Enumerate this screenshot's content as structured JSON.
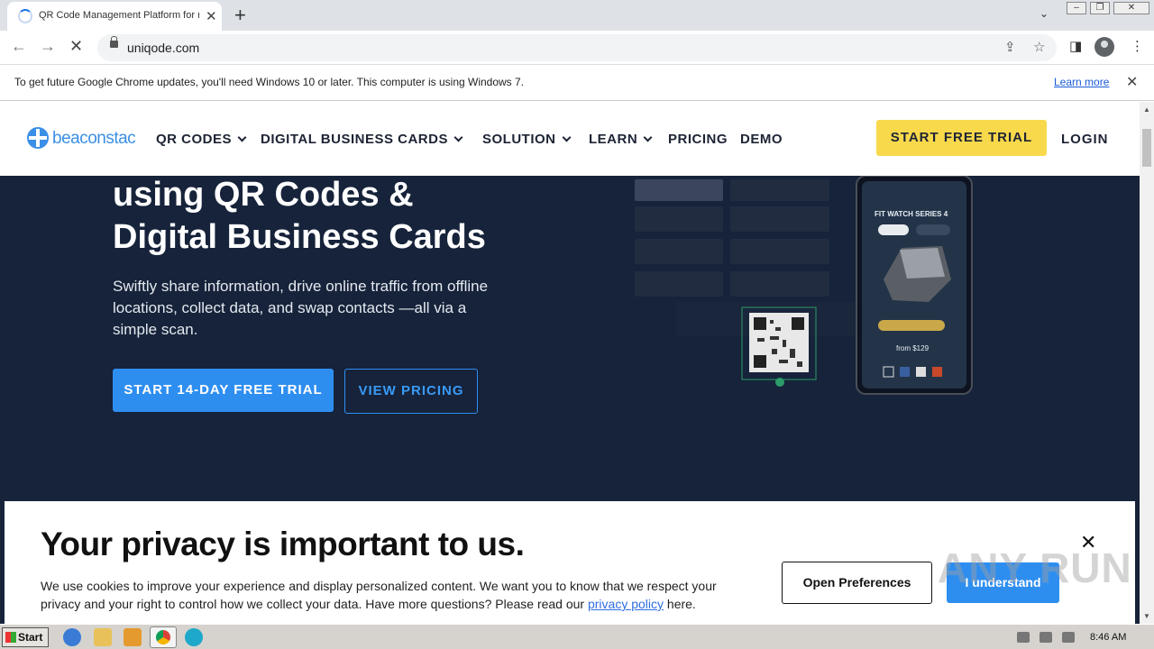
{
  "browser": {
    "tab_title": "QR Code Management Platform for m",
    "url": "uniqode.com",
    "infobar_text": "To get future Google Chrome updates, you'll need Windows 10 or later. This computer is using Windows 7.",
    "infobar_link": "Learn more"
  },
  "site": {
    "logo": "beaconstac",
    "nav": [
      "QR CODES",
      "DIGITAL BUSINESS CARDS",
      "SOLUTION",
      "LEARN",
      "PRICING",
      "DEMO"
    ],
    "cta_trial": "START FREE TRIAL",
    "login": "LOGIN"
  },
  "hero": {
    "title_line1": "using QR Codes &",
    "title_line2": "Digital Business Cards",
    "subtitle": "Swiftly share information, drive online traffic from offline locations, collect data, and swap contacts —all via a simple scan.",
    "primary_button": "START 14-DAY FREE TRIAL",
    "secondary_button": "VIEW PRICING",
    "illustration": {
      "phone_title": "FIT WATCH SERIES 4",
      "phone_price": "from $129"
    }
  },
  "cookie": {
    "title": "Your privacy is important to us.",
    "text_before_link": "We use cookies to improve your experience and display personalized content. We want you to know that we respect your privacy and your right to control how we collect your data. Have more questions? Please read our ",
    "link": "privacy policy",
    "text_after_link": " here.",
    "preferences_button": "Open Preferences",
    "accept_button": "I understand"
  },
  "watermark": "ANY RUN",
  "taskbar": {
    "start": "Start",
    "time": "8:46 AM"
  },
  "colors": {
    "hero_bg": "#16233a",
    "primary": "#2e8ef0",
    "cta_yellow": "#f9d94c",
    "logo_blue": "#3b8fe6"
  }
}
